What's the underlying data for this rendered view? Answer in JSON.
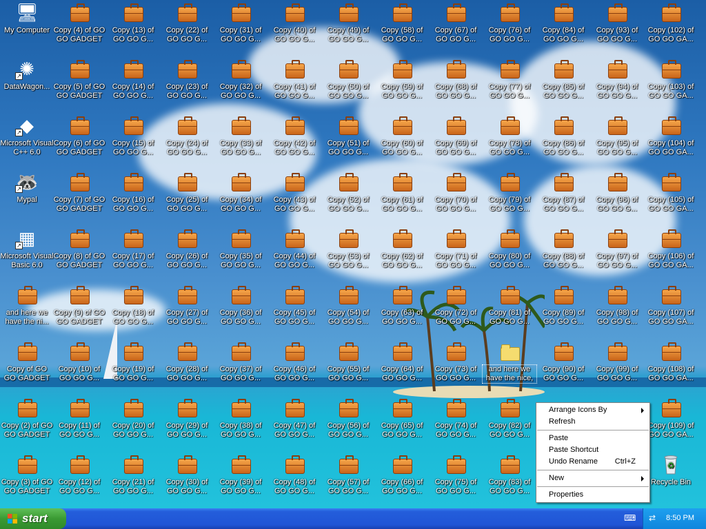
{
  "desktop": {
    "left_column": [
      {
        "label": "My Computer",
        "kind": "system",
        "icon": "my-computer-icon"
      },
      {
        "label": "DataWagon...",
        "kind": "shortcut",
        "icon": "datawagon-icon"
      },
      {
        "label": "Microsoft Visual C++ 6.0",
        "kind": "shortcut",
        "icon": "visual-cpp-icon"
      },
      {
        "label": "Mypal",
        "kind": "shortcut",
        "icon": "mypal-raccoon-icon"
      },
      {
        "label": "Microsoft Visual Basic 6.0",
        "kind": "shortcut",
        "icon": "visual-basic-icon"
      },
      {
        "label": "and here we have the ni...",
        "kind": "briefcase",
        "icon": "briefcase-icon"
      },
      {
        "label": "Copy of GO GO GADGET RA...",
        "kind": "briefcase",
        "icon": "briefcase-icon"
      },
      {
        "label": "Copy (2) of GO GO GADGET ...",
        "kind": "briefcase",
        "icon": "briefcase-icon"
      },
      {
        "label": "Copy (3) of GO GO GADGET ...",
        "kind": "briefcase",
        "icon": "briefcase-icon"
      }
    ],
    "grid_columns": [
      [
        "Copy (4) of GO GO GADGET ...",
        "Copy (5) of GO GO GADGET ...",
        "Copy (6) of GO GO GADGET ...",
        "Copy (7) of GO GO GADGET ...",
        "Copy (8) of GO GO GADGET ...",
        "Copy (9) of GO GO GADGET ...",
        "Copy (10) of GO GO G...",
        "Copy (11) of GO GO G...",
        "Copy (12) of GO GO G..."
      ],
      [
        "Copy (13) of GO GO G...",
        "Copy (14) of GO GO G...",
        "Copy (15) of GO GO G...",
        "Copy (16) of GO GO G...",
        "Copy (17) of GO GO G...",
        "Copy (18) of GO GO G...",
        "Copy (19) of GO GO G...",
        "Copy (20) of GO GO G...",
        "Copy (21) of GO GO G..."
      ],
      [
        "Copy (22) of GO GO G...",
        "Copy (23) of GO GO G...",
        "Copy (24) of GO GO G...",
        "Copy (25) of GO GO G...",
        "Copy (26) of GO GO G...",
        "Copy (27) of GO GO G...",
        "Copy (28) of GO GO G...",
        "Copy (29) of GO GO G...",
        "Copy (30) of GO GO G..."
      ],
      [
        "Copy (31) of GO GO G...",
        "Copy (32) of GO GO G...",
        "Copy (33) of GO GO G...",
        "Copy (34) of GO GO G...",
        "Copy (35) of GO GO G...",
        "Copy (36) of GO GO G...",
        "Copy (37) of GO GO G...",
        "Copy (38) of GO GO G...",
        "Copy (39) of GO GO G..."
      ],
      [
        "Copy (40) of GO GO G...",
        "Copy (41) of GO GO G...",
        "Copy (42) of GO GO G...",
        "Copy (43) of GO GO G...",
        "Copy (44) of GO GO G...",
        "Copy (45) of GO GO G...",
        "Copy (46) of GO GO G...",
        "Copy (47) of GO GO G...",
        "Copy (48) of GO GO G..."
      ],
      [
        "Copy (49) of GO GO G...",
        "Copy (50) of GO GO G...",
        "Copy (51) of GO GO G...",
        "Copy (52) of GO GO G...",
        "Copy (53) of GO GO G...",
        "Copy (54) of GO GO G...",
        "Copy (55) of GO GO G...",
        "Copy (56) of GO GO G...",
        "Copy (57) of GO GO G..."
      ],
      [
        "Copy (58) of GO GO G...",
        "Copy (59) of GO GO G...",
        "Copy (60) of GO GO G...",
        "Copy (61) of GO GO G...",
        "Copy (62) of GO GO G...",
        "Copy (63) of GO GO G...",
        "Copy (64) of GO GO G...",
        "Copy (65) of GO GO G...",
        "Copy (66) of GO GO G..."
      ],
      [
        "Copy (67) of GO GO G...",
        "Copy (68) of GO GO G...",
        "Copy (69) of GO GO G...",
        "Copy (70) of GO GO G...",
        "Copy (71) of GO GO G...",
        "Copy (72) of GO GO G...",
        "Copy (73) of GO GO G...",
        "Copy (74) of GO GO G...",
        "Copy (75) of GO GO G..."
      ],
      [
        "Copy (76) of GO GO G...",
        "Copy (77) of GO GO G...",
        "Copy (78) of GO GO G...",
        "Copy (79) of GO GO G...",
        "Copy (80) of GO GO G...",
        "Copy (81) of GO GO G...",
        "and here we have the nice, fresh trees",
        "Copy (82) of GO GO G...",
        "Copy (83) of GO GO G..."
      ],
      [
        "Copy (84) of GO GO G...",
        "Copy (85) of GO GO G...",
        "Copy (86) of GO GO G...",
        "Copy (87) of GO GO G...",
        "Copy (88) of GO GO G...",
        "Copy (89) of GO GO G...",
        "Copy (90) of GO GO G...",
        "",
        ""
      ],
      [
        "Copy (93) of GO GO G...",
        "Copy (94) of GO GO G...",
        "Copy (95) of GO GO G...",
        "Copy (96) of GO GO G...",
        "Copy (97) of GO GO G...",
        "Copy (98) of GO GO G...",
        "Copy (99) of GO GO G...",
        "",
        ""
      ],
      [
        "Copy (102) of GO GO GA...",
        "Copy (103) of GO GO GA...",
        "Copy (104) of GO GO GA...",
        "Copy (105) of GO GO GA...",
        "Copy (106) of GO GO GA...",
        "Copy (107) of GO GO GA...",
        "Copy (108) of GO GO GA...",
        "Copy (109) of GO GO GA...",
        "Recycle Bin"
      ]
    ],
    "selected_label": "and here we have the nice, fresh trees"
  },
  "context_menu": {
    "items": [
      {
        "label": "Arrange Icons By",
        "submenu": true
      },
      {
        "label": "Refresh"
      },
      {
        "separator": true
      },
      {
        "label": "Paste"
      },
      {
        "label": "Paste Shortcut"
      },
      {
        "label": "Undo Rename",
        "accel": "Ctrl+Z"
      },
      {
        "separator": true
      },
      {
        "label": "New",
        "submenu": true
      },
      {
        "separator": true
      },
      {
        "label": "Properties"
      }
    ]
  },
  "taskbar": {
    "start_label": "start",
    "clock": "8:50 PM",
    "tray_icons": [
      "keyboard-icon",
      "network-icon"
    ]
  },
  "colors": {
    "taskbar_blue": "#245edb",
    "start_green": "#3a9a33",
    "tray_blue": "#0f86dd"
  }
}
